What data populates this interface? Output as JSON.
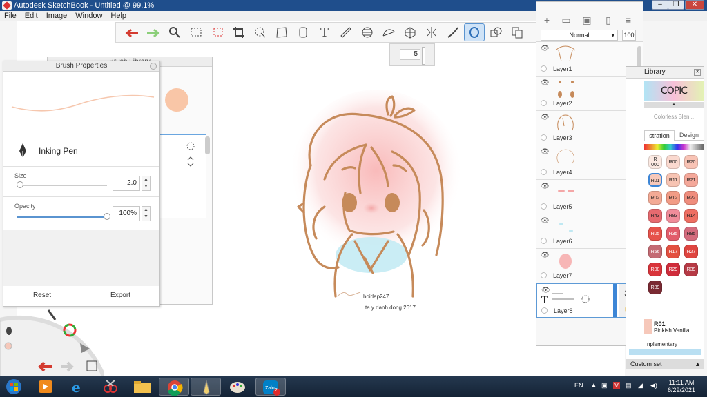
{
  "window": {
    "title": "Autodesk SketchBook - Untitled @ 99.1%"
  },
  "menu": [
    "File",
    "Edit",
    "Image",
    "Window",
    "Help"
  ],
  "toolbar": {
    "tools": [
      "undo-icon",
      "redo-icon",
      "zoom-icon",
      "select-rect-icon",
      "select-lasso-icon",
      "crop-icon",
      "transform-icon",
      "distort-icon",
      "fill-icon",
      "text-icon",
      "ruler-icon",
      "ellipse-guide-icon",
      "french-curve-icon",
      "perspective-icon",
      "symmetry-icon",
      "stroke-icon",
      "ellipse-tool-icon",
      "shape-icon",
      "copy-icon"
    ],
    "active": "ellipse-tool-icon"
  },
  "size_popup": {
    "value": "5"
  },
  "brush_library": {
    "title": "Brush Library"
  },
  "brush_properties": {
    "title": "Brush Properties",
    "brush_name": "Inking Pen",
    "size_label": "Size",
    "size_value": "2.0",
    "size_level": 0.03,
    "opacity_label": "Opacity",
    "opacity_value": "100%",
    "opacity_level": 1.0,
    "reset": "Reset",
    "export": "Export"
  },
  "artwork": {
    "caption1": "hoidap247",
    "caption2": "ta y danh dong 2617"
  },
  "layers": {
    "blend_mode": "Normal",
    "opacity": "100",
    "items": [
      {
        "name": "Layer1"
      },
      {
        "name": "Layer2"
      },
      {
        "name": "Layer3"
      },
      {
        "name": "Layer4"
      },
      {
        "name": "Layer5"
      },
      {
        "name": "Layer6"
      },
      {
        "name": "Layer7"
      },
      {
        "name": "Layer8"
      }
    ]
  },
  "copic": {
    "title": "Library",
    "logo": "COPIC",
    "colorless": "Colorless Blen...",
    "tab1": "stration",
    "tab2": "Design",
    "swatches": [
      {
        "label": "R\n000",
        "color": "#fbe9e2"
      },
      {
        "label": "R00",
        "color": "#fad9cf"
      },
      {
        "label": "R20",
        "color": "#f8c3b5"
      },
      {
        "label": "R01",
        "color": "#f6c8ba"
      },
      {
        "label": "R11",
        "color": "#f7c4b3"
      },
      {
        "label": "R21",
        "color": "#f4a89a"
      },
      {
        "label": "R02",
        "color": "#f3aa95"
      },
      {
        "label": "R12",
        "color": "#f29c86"
      },
      {
        "label": "R22",
        "color": "#ef8d7d"
      },
      {
        "label": "R43",
        "color": "#e66a6f"
      },
      {
        "label": "R83",
        "color": "#f08c9a"
      },
      {
        "label": "R14",
        "color": "#ee6e62"
      },
      {
        "label": "R05",
        "color": "#e6524a"
      },
      {
        "label": "R35",
        "color": "#e25c6b"
      },
      {
        "label": "R85",
        "color": "#d46b7d"
      },
      {
        "label": "R56",
        "color": "#c46a73"
      },
      {
        "label": "R17",
        "color": "#e35040"
      },
      {
        "label": "R27",
        "color": "#df4540"
      },
      {
        "label": "R08",
        "color": "#d9343a"
      },
      {
        "label": "R29",
        "color": "#cf2c3b"
      },
      {
        "label": "R39",
        "color": "#b63a45"
      },
      {
        "label": "R89",
        "color": "#7a2a33"
      }
    ],
    "selected_code": "R01",
    "selected_name": "Pinkish Vanilla",
    "complementary": "nplementary",
    "custom_set": "Custom set"
  },
  "taskbar": {
    "lang": "EN",
    "time": "11:11 AM",
    "date": "6/29/2021",
    "zalo_badge": "2"
  },
  "colors": {
    "accent": "#5a94d0",
    "line_art": "#c68a5a",
    "blush": "#f4a7a7",
    "cheek": "#e99e90",
    "cloth": "#bfe8f2"
  }
}
